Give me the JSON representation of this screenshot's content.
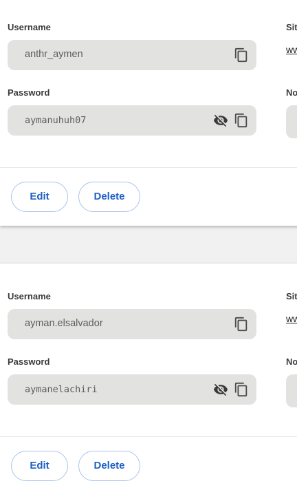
{
  "labels": {
    "username": "Username",
    "password": "Password",
    "site": "Sit",
    "notes": "No"
  },
  "buttons": {
    "edit": "Edit",
    "delete": "Delete"
  },
  "entries": [
    {
      "username": "anthr_aymen",
      "password": "aymanuhuh07",
      "site_link": "ww"
    },
    {
      "username": "ayman.elsalvador",
      "password": "aymanelachiri",
      "site_link": "ww"
    }
  ],
  "icons": {
    "copy": "copy-icon",
    "visibility_off": "eye-off-icon"
  },
  "colors": {
    "accent": "#1d5fc4",
    "button_border": "#a9c4ea",
    "field_bg": "#e2e3e1",
    "page_bg": "#f1f1f1"
  }
}
